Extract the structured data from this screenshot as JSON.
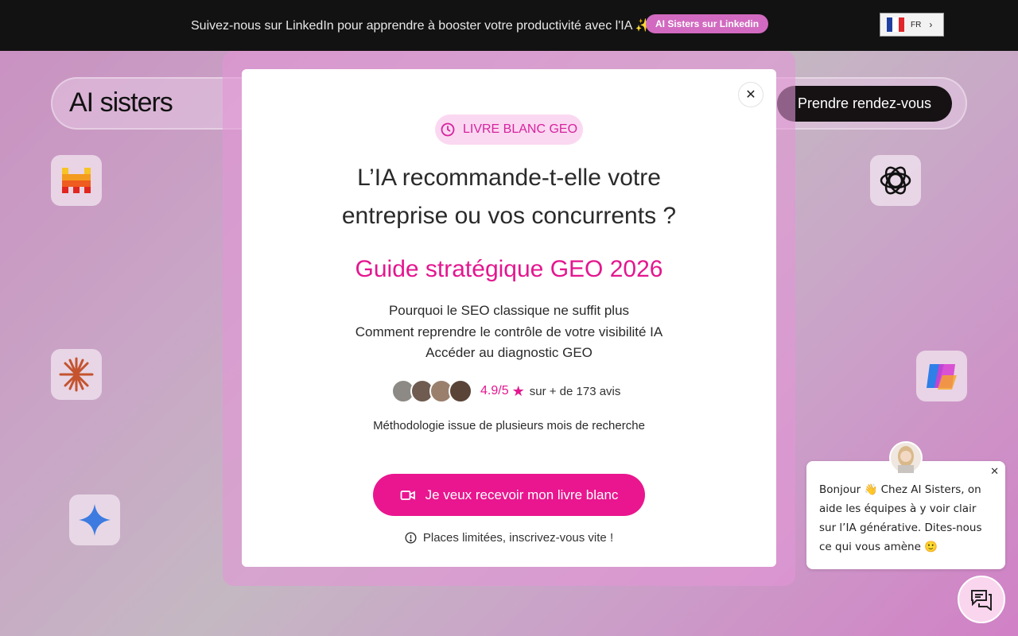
{
  "topbar": {
    "message": "Suivez-nous sur LinkedIn pour apprendre à booster votre productivité avec l'IA ✨ !",
    "linkedin_button": "AI Sisters sur Linkedin",
    "language": "FR"
  },
  "header": {
    "logo": "AI sisters",
    "cta": "Prendre rendez-vous"
  },
  "modal": {
    "badge": "LIVRE BLANC GEO",
    "title_line1": "L’IA recommande-t-elle votre",
    "title_line2": "entreprise ou vos concurrents ?",
    "subtitle": "Guide stratégique GEO 2026",
    "bullets": [
      "Pourquoi le SEO classique ne suffit plus",
      "Comment reprendre le contrôle de votre visibilité IA",
      "Accéder au diagnostic GEO"
    ],
    "rating_score": "4.9/5",
    "rating_text": "sur + de 173 avis",
    "methodology": "Méthodologie issue de plusieurs mois de recherche",
    "cta": "Je veux recevoir mon livre blanc",
    "limited": "Places limitées, inscrivez-vous vite !"
  },
  "chat": {
    "message": "Bonjour 👋 Chez AI Sisters, on aide les équipes à y voir clair sur l’IA générative. Dites-nous ce qui vous amène 🙂"
  },
  "colors": {
    "accent": "#e9168f",
    "topbar_bg": "#121212",
    "badge_bg": "#fbd8f1"
  }
}
